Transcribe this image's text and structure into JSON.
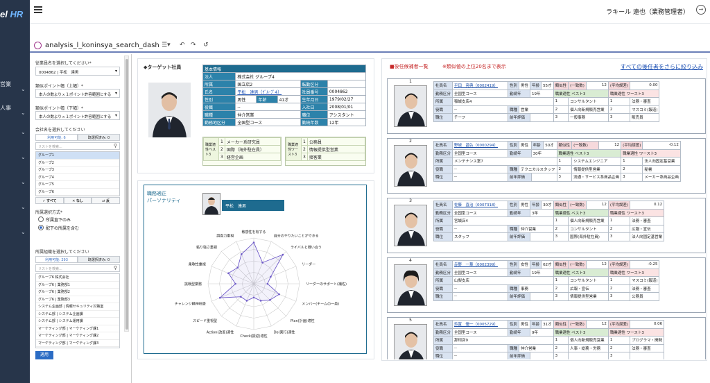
{
  "app": {
    "brand_left": "el",
    "brand_right": "HR",
    "user": "ラキール 遠也（業務管理者）"
  },
  "nav": {
    "items": [
      {
        "label": "営業"
      },
      {
        "label": "人事"
      }
    ]
  },
  "tab": {
    "title": "analysis_l_koninsya_search_dash"
  },
  "filters": {
    "employee_label": "従業員名を選択してください*",
    "employee_value": "0004862 | 平松　達男",
    "similar_upper_label": "類似ポイント幅（上幅）*",
    "similar_upper_value": "本人の数よりｘ１ポイント許容範囲とする",
    "similar_lower_label": "類似ポイント幅（下幅）*",
    "similar_lower_value": "本人の数よりｘ１ポイント許容範囲とする",
    "company_label": "会社名を選択してください",
    "tab_available": "利用可能: 6",
    "tab_selected": "既選択済み: 0",
    "search_placeholder": "リストを検索...",
    "companies": [
      "グループ1",
      "グループ2",
      "グループ3",
      "グループ4",
      "グループ5",
      "グループ6"
    ],
    "btn_all": "すべて",
    "btn_none": "なし",
    "btn_invert": "反",
    "dept_method_label": "所属選択方式*",
    "dept_method_opt1": "所属直下のみ",
    "dept_method_opt2": "配下の所属を含む",
    "dept_label": "所属組織を選択してください",
    "dept_tab_available": "利用可能: 293",
    "dept_tab_selected": "既選択済み: 0",
    "depts": [
      "グループ6 株式会社",
      "グループ6 | 業務部1",
      "グループ6 | 業務部2",
      "グループ6 | 業務部3",
      "システム企画部 | 情報セキュリティ対策室",
      "システム部 | システム企画課",
      "システム部 | システム運用課",
      "マーケティング部 | マーケティング課1",
      "マーケティング部 | マーケティング課2",
      "マーケティング部 | マーケティング課3"
    ],
    "apply": "適用"
  },
  "target": {
    "heading": "◆ターゲット社員",
    "info_heading": "基本情報",
    "rows": [
      [
        "法人",
        "株式会社 グループ4",
        "",
        "",
        "",
        ""
      ],
      [
        "所属",
        "国立店2",
        "",
        "",
        "転勤区分",
        ""
      ],
      [
        "氏名",
        "平松　達男（ｸﾞﾙｰﾌﾟ4）",
        "",
        "",
        "社員番号",
        "0004862"
      ],
      [
        "性別",
        "男性",
        "年齢",
        "41才",
        "生年月日",
        "1979/02/27"
      ],
      [
        "役職",
        "--",
        "",
        "",
        "入社日",
        "2008/01/01"
      ],
      [
        "職種",
        "仲介営業",
        "",
        "",
        "職位",
        "アシスタント"
      ],
      [
        "勤務地区分",
        "全国型コース",
        "",
        "",
        "勤続年数",
        "12年"
      ]
    ],
    "apt_good_label": "職業適性ベスト3",
    "apt_good": [
      "メーカー系研究員",
      "国際（海外駐在員）",
      "経営企画"
    ],
    "apt_bad_label": "職業適性ワースト3",
    "apt_bad": [
      "公務員",
      "情報提供型営業",
      "接客業"
    ]
  },
  "persona": {
    "title_line1": "職務適正",
    "title_line2": "パーソナリティ",
    "name": "平松　達男"
  },
  "chart_data": {
    "type": "radar",
    "categories": [
      "敏感性を有する",
      "自分のやりたいことができる",
      "ライバルと戦い合う",
      "リーダー",
      "リーダーのサポート(補佐)",
      "メンバー(チームの一員)",
      "Plan(計画)適性",
      "Do(実行)適性",
      "Check(振返)適性",
      "Action(改善)適性",
      "スピード重視型",
      "チャレンジ精神旺盛",
      "挑戦型業務",
      "柔軟性重視",
      "粘り強さ重視",
      "調査力重視"
    ],
    "series": [
      {
        "values": [
          9,
          5,
          9,
          4,
          3,
          6,
          5,
          4,
          3,
          4,
          4,
          8,
          4,
          6,
          5,
          7
        ]
      }
    ],
    "rmax": 10
  },
  "candidates": {
    "heading": "■後任候補者一覧",
    "note": "※類似値の上位20名まで表示",
    "narrow_link": "すべての後任者をさらに絞り込み",
    "list": [
      {
        "no": "1",
        "name": "平田　亮典（0002419）",
        "sex": "男性",
        "age": "55才",
        "score": "12",
        "err": "0.00",
        "course": "全国型コース",
        "tenure": "19年",
        "dept": "稲城支店4",
        "role": "--",
        "job": "営業",
        "pos": "チーフ",
        "best": [
          "コンサルタント",
          "個人向新規販売営業",
          "一般事務"
        ],
        "worst": [
          "法務・審査",
          "マスコミ(報道)",
          "販売員"
        ]
      },
      {
        "no": "2",
        "name": "野城　昌弘（0000294）",
        "sex": "男性",
        "age": "50才",
        "score": "12",
        "err": "-0.12",
        "course": "全国型コース",
        "tenure": "30年",
        "dept": "メンテナンス室7",
        "role": "--",
        "job": "テクニカルスタッフ",
        "pos": "--",
        "best": [
          "システムエンジニア",
          "情報提供型営業",
          "流通・サービス系商品企画"
        ],
        "worst": [
          "法人向固定基営業",
          "秘書",
          "メーカー系商品企画"
        ]
      },
      {
        "no": "3",
        "name": "佐藤　直治（0007318）",
        "sex": "男性",
        "age": "30才",
        "score": "12",
        "err": "0.12",
        "course": "全国型コース",
        "tenure": "3年",
        "dept": "宮城店4",
        "role": "--",
        "job": "仲介営業",
        "pos": "スタッフ",
        "best": [
          "個人向新規販売営業",
          "コンサルタント",
          "国際(海外駐在員)"
        ],
        "worst": [
          "法務・審査",
          "広報・宣伝",
          "法人向固定基営業"
        ]
      },
      {
        "no": "4",
        "name": "赤野　一華（0002399）",
        "sex": "女性",
        "age": "62才",
        "score": "12",
        "err": "-0.25",
        "course": "全国型コース",
        "tenure": "19年",
        "dept": "山梨支店",
        "role": "--",
        "job": "事務",
        "pos": "--",
        "best": [
          "コンサルタント",
          "広報・宣伝",
          "情報提供型営業"
        ],
        "worst": [
          "マスコミ(報道)",
          "法務・審査",
          "公務員"
        ]
      },
      {
        "no": "5",
        "name": "鈴置　優一（0005729）",
        "sex": "男性",
        "age": "31才",
        "score": "12",
        "err": "0.06",
        "course": "全国型コース",
        "tenure": "9年",
        "dept": "那珂店9",
        "role": "--",
        "job": "仲介営業",
        "pos": "--",
        "best": [
          "個人向新規販売営業",
          "人事・総務・労務",
          ""
        ],
        "worst": [
          "プログラマ・開発",
          "法務・審査",
          ""
        ]
      }
    ],
    "labels": {
      "name": "社員名",
      "sex": "性別",
      "age": "年齢",
      "similar": "類似性",
      "match": "(一致数)",
      "err": "(平均誤差)",
      "course": "勤務区分",
      "tenure": "勤続年",
      "best": "職業適性 ベスト3",
      "worst": "職業適性 ワースト3",
      "dept": "所属",
      "role": "役職",
      "job": "職種",
      "pos": "職位",
      "eval": "前年評価"
    }
  }
}
